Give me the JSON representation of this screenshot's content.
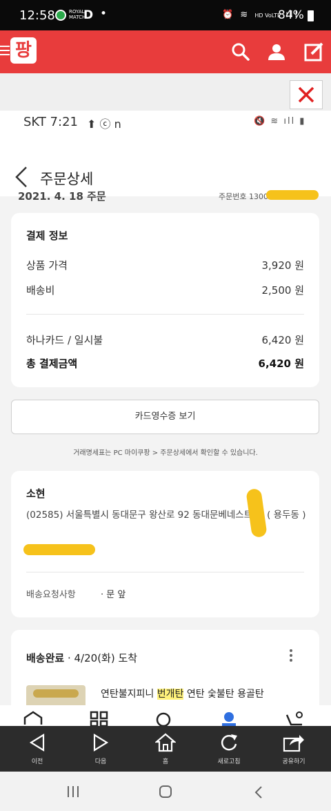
{
  "status_bar": {
    "time": "12:58",
    "app_badge": "ROYAL MATCH",
    "app_letter": "D",
    "dot": "•",
    "network": "HD VoLTE",
    "battery": "84%"
  },
  "app_header": {
    "logo_text": "팡"
  },
  "inner_status": {
    "carrier_time": "SKT 7:21",
    "icons_text": "⬆ ⓒ n",
    "sys_icons_text": "🔇 ≋ ıll ▮"
  },
  "page": {
    "title": "주문상세"
  },
  "order": {
    "date_label": "2021. 4. 18 주문",
    "number_label": "주문번호 1300"
  },
  "payment": {
    "heading": "결제 정보",
    "rows": [
      {
        "label": "상품 가격",
        "value": "3,920 원"
      },
      {
        "label": "배송비",
        "value": "2,500 원"
      },
      {
        "label": "하나카드 / 일시불",
        "value": "6,420 원"
      },
      {
        "label": "총 결제금액",
        "value": "6,420 원"
      }
    ]
  },
  "receipt_button": "카드영수증 보기",
  "notice": "거래명세표는 PC 마이쿠팡 > 주문상세에서 확인할 수 있습니다.",
  "address": {
    "name": "소현",
    "line": "(02585) 서울특별시 동대문구 왕산로 92 동대문베네스트    호 ( 용두동 )",
    "request_label": "배송요청사항",
    "request_value": "· 문 앞"
  },
  "shipping": {
    "status": "배송완료",
    "arrival": " · 4/20(화) 도착",
    "product_prefix": "연탄불지피니 ",
    "product_highlight": "번개탄",
    "product_suffix": " 연탄 숯불탄 용골탄"
  },
  "browser_bar": {
    "items": [
      "이전",
      "다음",
      "홈",
      "새로고침",
      "공유하기"
    ]
  },
  "colors": {
    "brand_red": "#e83c3c",
    "highlight": "#fff27a",
    "redaction": "#f6c21b"
  }
}
